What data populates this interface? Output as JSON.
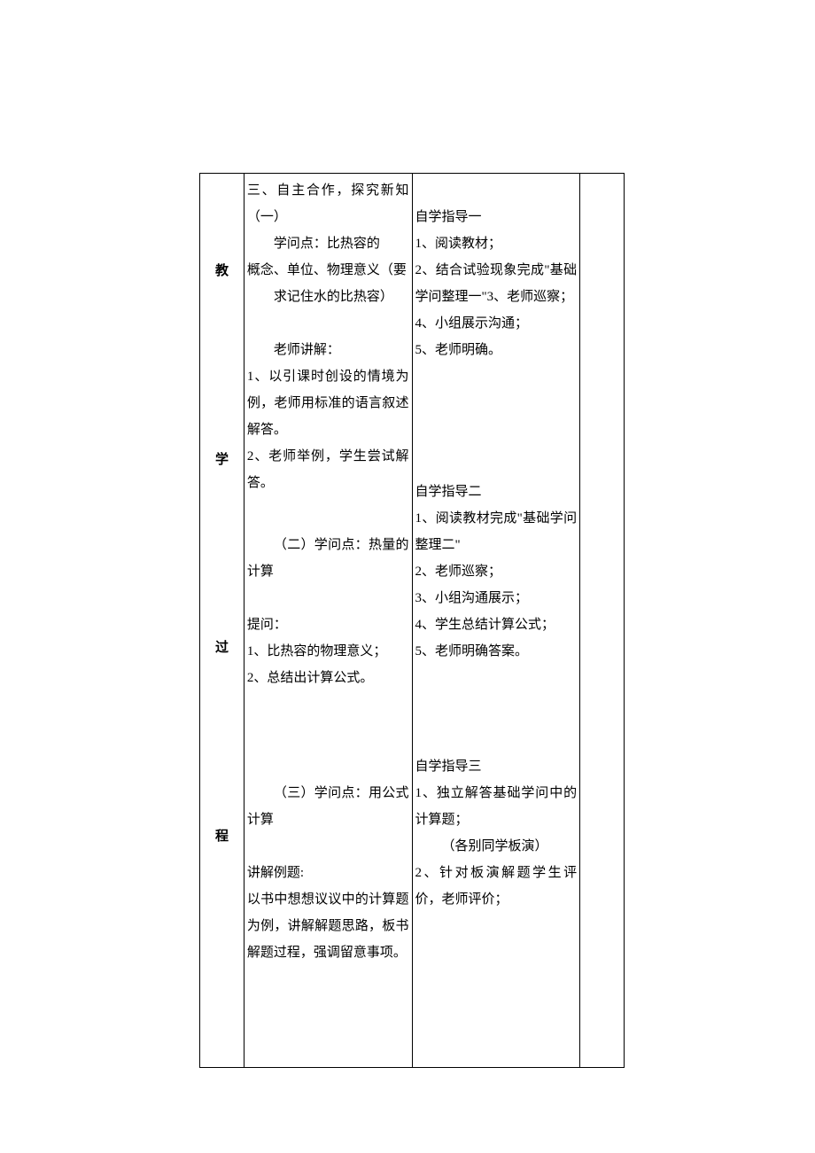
{
  "rowLabel": {
    "char1": "教",
    "char2": "学",
    "char3": "过",
    "char4": "程"
  },
  "section1": {
    "left": {
      "title": "三、自主合作，探究新知（一）",
      "line1": "学问点：比热容的",
      "line2": "概念、单位、物理意义（要",
      "line3": "求记住水的比热容）",
      "teacherHeader": "老师讲解：",
      "teacherLine1": "1、以引课时创设的情境为例，老师用标准的语言叙述解答。",
      "teacherLine2": "2、老师举例，学生尝试解答。"
    },
    "right": {
      "title": "自学指导一",
      "item1": "1、阅读教材；",
      "item2": "2、结合试验现象完成\"基础学问整理一\"3、老师巡察；",
      "item3": "4、小组展示沟通；",
      "item4": "5、老师明确。"
    }
  },
  "section2": {
    "left": {
      "title": "（二）学问点：热量的计算",
      "questionHeader": "提问：",
      "q1": "1、比热容的物理意义；",
      "q2": "2、总结出计算公式。"
    },
    "right": {
      "title": "自学指导二",
      "item1": "1、阅读教材完成\"基础学问整理二\"",
      "item2": "2、老师巡察；",
      "item3": "3、小组沟通展示；",
      "item4": "4、学生总结计算公式；",
      "item5": "5、老师明确答案。"
    }
  },
  "section3": {
    "left": {
      "title": "（三）学问点：用公式计算",
      "exampleHeader": "讲解例题:",
      "exampleText": "以书中想想议议中的计算题为例，讲解解题思路，板书解题过程，强调留意事项。"
    },
    "right": {
      "title": "自学指导三",
      "item1": "1、独立解答基础学问中的计算题；",
      "item2": "（各别同学板演）",
      "item3": "2、针对板演解题学生评价，老师评价；"
    }
  }
}
